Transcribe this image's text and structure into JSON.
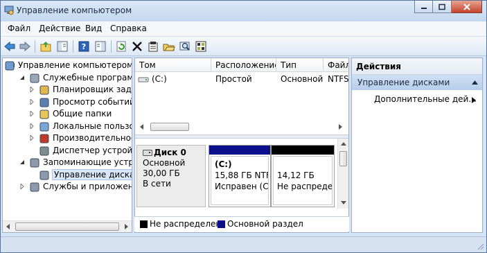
{
  "window": {
    "title": "Управление компьютером"
  },
  "menu": [
    {
      "label": "Файл"
    },
    {
      "label": "Действие"
    },
    {
      "label": "Вид"
    },
    {
      "label": "Справка"
    }
  ],
  "toolbar": {
    "icons": [
      "back-icon",
      "forward-icon",
      "up-folder-icon",
      "show-hide-tree-icon",
      "help-icon",
      "show-hide-action-pane-icon",
      "refresh-icon",
      "delete-icon",
      "properties-icon",
      "open-icon",
      "search-icon",
      "export-icon"
    ]
  },
  "tree": [
    {
      "label": "Управление компьютером (л",
      "icon": "computer-icon",
      "indent": 0,
      "arrow": "expanded"
    },
    {
      "label": "Служебные программы",
      "icon": "tools-icon",
      "indent": 1,
      "arrow": "expanded"
    },
    {
      "label": "Планировщик заданий",
      "icon": "clock-icon",
      "indent": 2,
      "arrow": "collapsed"
    },
    {
      "label": "Просмотр событий",
      "icon": "event-viewer-icon",
      "indent": 2,
      "arrow": "collapsed"
    },
    {
      "label": "Общие папки",
      "icon": "shared-folder-icon",
      "indent": 2,
      "arrow": "collapsed"
    },
    {
      "label": "Локальные пользовате",
      "icon": "users-icon",
      "indent": 2,
      "arrow": "collapsed"
    },
    {
      "label": "Производительность",
      "icon": "performance-icon",
      "indent": 2,
      "arrow": "collapsed"
    },
    {
      "label": "Диспетчер устройств",
      "icon": "device-manager-icon",
      "indent": 2,
      "arrow": "none"
    },
    {
      "label": "Запоминающие устройст",
      "icon": "storage-icon",
      "indent": 1,
      "arrow": "expanded"
    },
    {
      "label": "Управление дисками",
      "icon": "disk-management-icon",
      "indent": 2,
      "arrow": "none",
      "selected": true
    },
    {
      "label": "Службы и приложения",
      "icon": "services-icon",
      "indent": 1,
      "arrow": "collapsed"
    }
  ],
  "volumes": {
    "columns": [
      "Том",
      "Расположение",
      "Тип",
      "Файл"
    ],
    "rows": [
      {
        "volume": "(C:)",
        "layout": "Простой",
        "type": "Основной",
        "fs": "NTFS"
      }
    ]
  },
  "disk": {
    "name": "Диск 0",
    "type": "Основной",
    "size": "30,00 ГБ",
    "status": "В сети",
    "partitions": [
      {
        "name": "(C:)",
        "size": "15,88 ГБ NTFS",
        "status": "Исправен (Си",
        "bar_color": "#0b0f8c"
      },
      {
        "name": "",
        "size": "14,12 ГБ",
        "status": "Не распредел",
        "bar_color": "#000000"
      }
    ]
  },
  "legend": [
    {
      "label": "Не распределен",
      "color": "#000000"
    },
    {
      "label": "Основной раздел",
      "color": "#0b0f8c"
    }
  ],
  "actions": {
    "title": "Действия",
    "section": "Управление дисками",
    "item": "Дополнительные дей..."
  }
}
